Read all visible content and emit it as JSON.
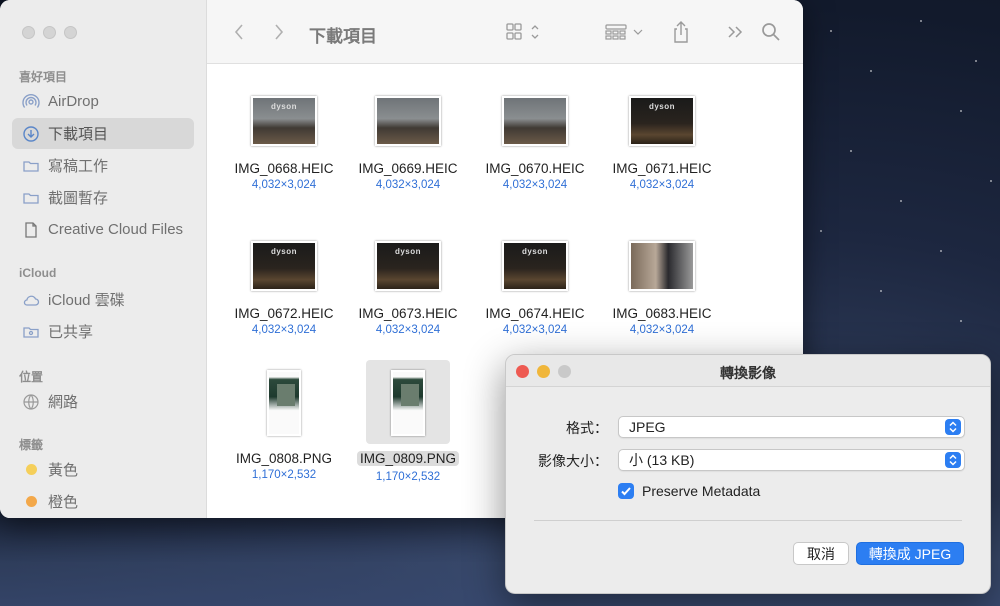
{
  "finder": {
    "title": "下載項目",
    "sidebar": {
      "favorites_header": "喜好項目",
      "favorites": [
        {
          "label": "AirDrop",
          "icon": "airdrop-icon"
        },
        {
          "label": "下載項目",
          "icon": "download-icon",
          "selected": true
        },
        {
          "label": "寫稿工作",
          "icon": "folder-icon"
        },
        {
          "label": "截圖暫存",
          "icon": "folder-icon"
        },
        {
          "label": "Creative Cloud Files",
          "icon": "document-icon"
        }
      ],
      "icloud_header": "iCloud",
      "icloud": [
        {
          "label": "iCloud 雲碟",
          "icon": "cloud-icon"
        },
        {
          "label": "已共享",
          "icon": "shared-folder-icon"
        }
      ],
      "locations_header": "位置",
      "locations": [
        {
          "label": "網路",
          "icon": "network-icon"
        }
      ],
      "tags_header": "標籤",
      "tags": [
        {
          "label": "黃色",
          "color": "#f5cf5a"
        },
        {
          "label": "橙色",
          "color": "#f3a84a"
        }
      ]
    },
    "files": [
      {
        "name": "IMG_0668.HEIC",
        "size": "4,032×3,024",
        "thumb": "light",
        "brand": "dyson"
      },
      {
        "name": "IMG_0669.HEIC",
        "size": "4,032×3,024",
        "thumb": "light",
        "brand": ""
      },
      {
        "name": "IMG_0670.HEIC",
        "size": "4,032×3,024",
        "thumb": "light",
        "brand": ""
      },
      {
        "name": "IMG_0671.HEIC",
        "size": "4,032×3,024",
        "thumb": "dark",
        "brand": "dyson"
      },
      {
        "name": "IMG_0672.HEIC",
        "size": "4,032×3,024",
        "thumb": "dark",
        "brand": "dyson"
      },
      {
        "name": "IMG_0673.HEIC",
        "size": "4,032×3,024",
        "thumb": "dark",
        "brand": "dyson"
      },
      {
        "name": "IMG_0674.HEIC",
        "size": "4,032×3,024",
        "thumb": "dark",
        "brand": "dyson"
      },
      {
        "name": "IMG_0683.HEIC",
        "size": "4,032×3,024",
        "thumb": "people",
        "brand": ""
      },
      {
        "name": "IMG_0808.PNG",
        "size": "1,170×2,532",
        "thumb": "portrait",
        "brand": ""
      },
      {
        "name": "IMG_0809.PNG",
        "size": "1,170×2,532",
        "thumb": "portrait",
        "brand": "",
        "selected": true
      }
    ]
  },
  "dialog": {
    "title": "轉換影像",
    "format_label": "格式：",
    "format_value": "JPEG",
    "size_label": "影像大小：",
    "size_value": "小 (13 KB)",
    "preserve_label": "Preserve Metadata",
    "preserve_checked": true,
    "cancel_label": "取消",
    "convert_label": "轉換成 JPEG",
    "traffic_colors": [
      "#ee5a52",
      "#f0b63a",
      "#c9c9c9"
    ]
  },
  "colors": {
    "accent": "#2c7ef2",
    "size_text": "#2f6fd6"
  }
}
